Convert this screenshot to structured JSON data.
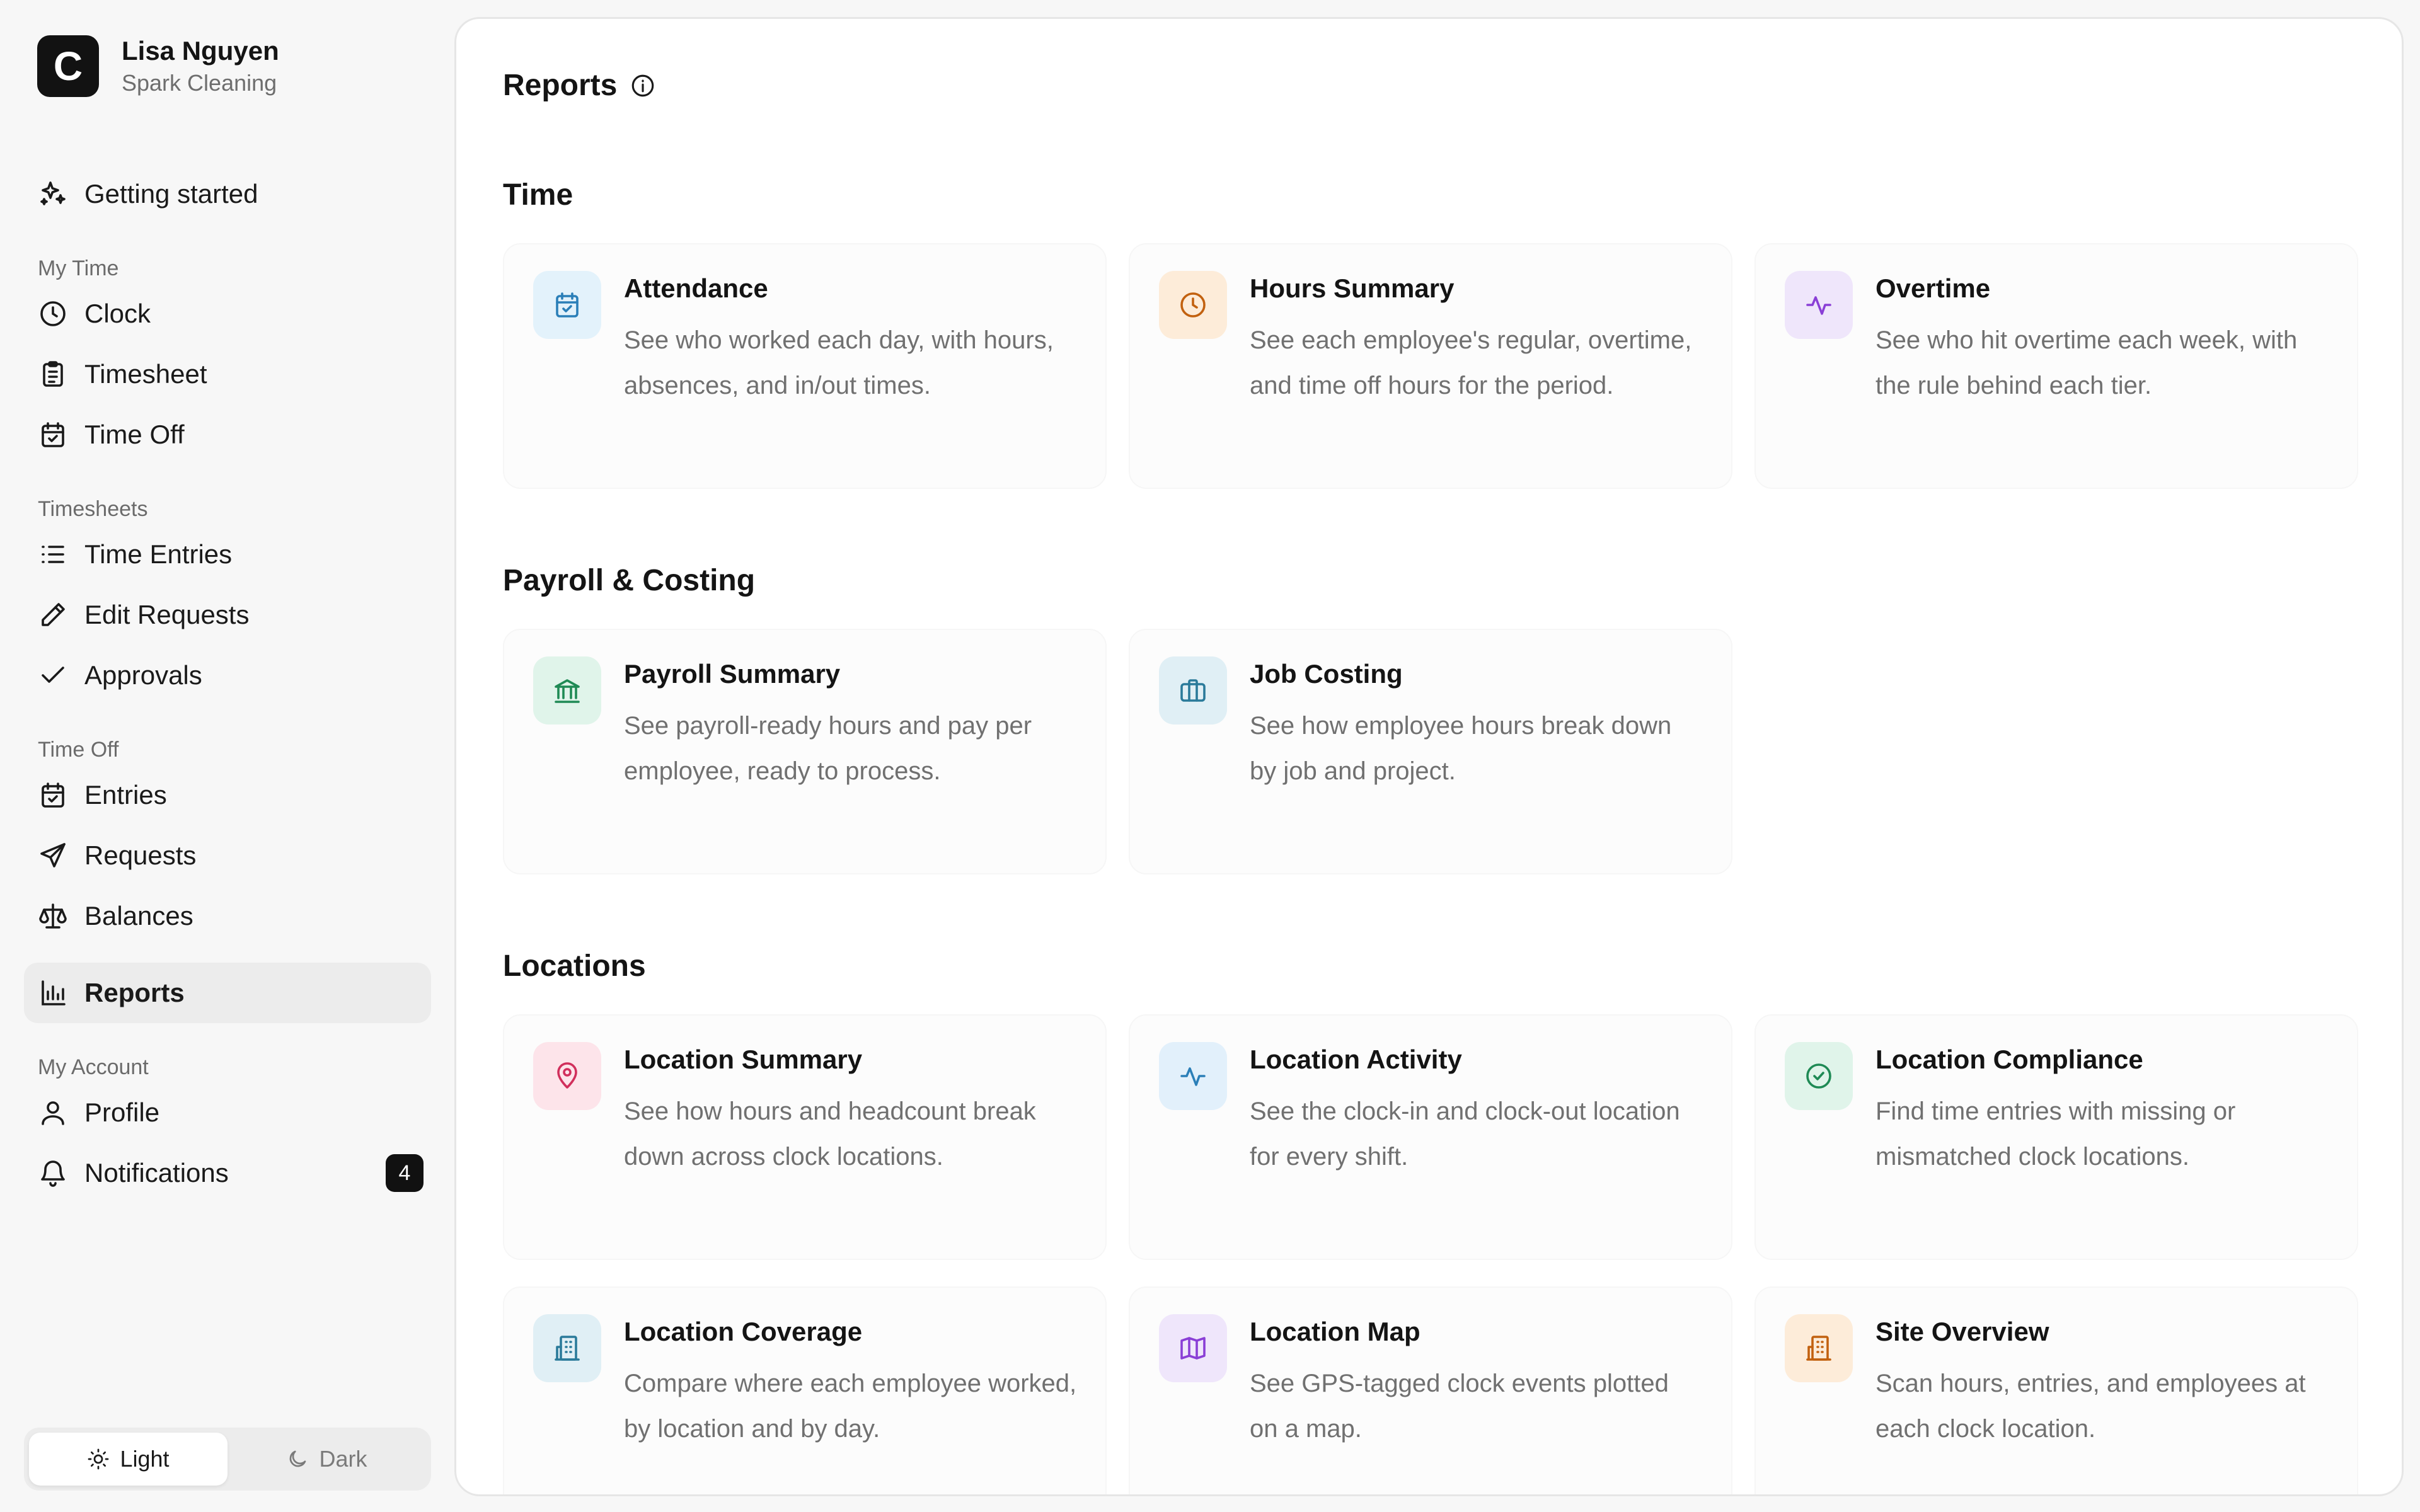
{
  "user": {
    "name": "Lisa Nguyen",
    "company": "Spark Cleaning",
    "logo_letter": "C"
  },
  "sidebar": {
    "getting_started": "Getting started",
    "sections": {
      "my_time": "My Time",
      "timesheets": "Timesheets",
      "time_off": "Time Off",
      "my_account": "My Account"
    },
    "items": {
      "clock": "Clock",
      "timesheet": "Timesheet",
      "time_off": "Time Off",
      "time_entries": "Time Entries",
      "edit_requests": "Edit Requests",
      "approvals": "Approvals",
      "entries": "Entries",
      "requests": "Requests",
      "balances": "Balances",
      "reports": "Reports",
      "profile": "Profile",
      "notifications": "Notifications"
    },
    "notifications_count": "4",
    "theme": {
      "light": "Light",
      "dark": "Dark",
      "selected": "light"
    }
  },
  "page": {
    "title": "Reports",
    "sections": {
      "time": "Time",
      "payroll": "Payroll & Costing",
      "locations": "Locations"
    }
  },
  "cards": {
    "attendance": {
      "title": "Attendance",
      "desc": "See who worked each day, with hours, absences, and in/out times.",
      "icon": "calendar-check-icon",
      "bg": "#e3f2fb",
      "fg": "#2b7fb8"
    },
    "hours_summary": {
      "title": "Hours Summary",
      "desc": "See each employee's regular, overtime, and time off hours for the period.",
      "icon": "clock-icon",
      "bg": "#fdecd9",
      "fg": "#c2610f"
    },
    "overtime": {
      "title": "Overtime",
      "desc": "See who hit overtime each week, with the rule behind each tier.",
      "icon": "activity-icon",
      "bg": "#efe6fb",
      "fg": "#8a3fd6"
    },
    "payroll_summary": {
      "title": "Payroll Summary",
      "desc": "See payroll-ready hours and pay per employee, ready to process.",
      "icon": "bank-icon",
      "bg": "#e0f4ea",
      "fg": "#1f8a55"
    },
    "job_costing": {
      "title": "Job Costing",
      "desc": "See how employee hours break down by job and project.",
      "icon": "briefcase-icon",
      "bg": "#e0eff5",
      "fg": "#2a7a9a"
    },
    "location_summary": {
      "title": "Location Summary",
      "desc": "See how hours and headcount break down across clock locations.",
      "icon": "map-pin-icon",
      "bg": "#fde4ea",
      "fg": "#d12f5c"
    },
    "location_activity": {
      "title": "Location Activity",
      "desc": "See the clock-in and clock-out location for every shift.",
      "icon": "activity-icon",
      "bg": "#e2f0fb",
      "fg": "#2b7fb8"
    },
    "location_compliance": {
      "title": "Location Compliance",
      "desc": "Find time entries with missing or mismatched clock locations.",
      "icon": "check-circle-icon",
      "bg": "#e0f4ea",
      "fg": "#1f8a55"
    },
    "location_coverage": {
      "title": "Location Coverage",
      "desc": "Compare where each employee worked, by location and by day.",
      "icon": "building-icon",
      "bg": "#e0eff5",
      "fg": "#2a7a9a"
    },
    "location_map": {
      "title": "Location Map",
      "desc": "See GPS-tagged clock events plotted on a map.",
      "icon": "map-icon",
      "bg": "#efe6fb",
      "fg": "#8a3fd6"
    },
    "site_overview": {
      "title": "Site Overview",
      "desc": "Scan hours, entries, and employees at each clock location.",
      "icon": "building-icon",
      "bg": "#fdecd9",
      "fg": "#c2610f"
    }
  }
}
